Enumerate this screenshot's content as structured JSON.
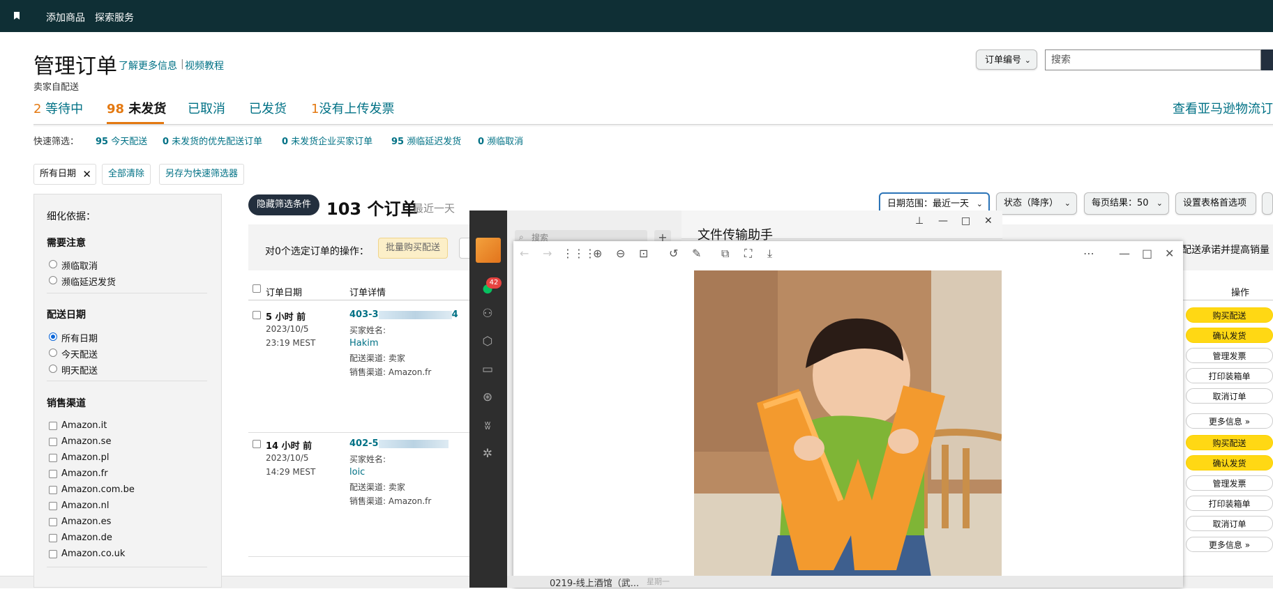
{
  "topbar": {
    "add_product": "添加商品",
    "explore": "探索服务"
  },
  "header": {
    "title": "管理订单",
    "learn_more": "了解更多信息",
    "video": "视频教程",
    "subtitle": "卖家自配送",
    "search_select": "订单编号",
    "search_placeholder": "搜索"
  },
  "tabs": [
    {
      "num": "2",
      "label": " 等待中"
    },
    {
      "num": "98",
      "label": " 未发货"
    },
    {
      "num": "",
      "label": "已取消"
    },
    {
      "num": "",
      "label": "已发货"
    },
    {
      "num": "1",
      "label": "没有上传发票"
    }
  ],
  "tab_right": "查看亚马逊物流订",
  "quick_filter": {
    "label": "快速筛选：",
    "items": [
      {
        "n": "95",
        "t": " 今天配送"
      },
      {
        "n": "0",
        "t": " 未发货的优先配送订单"
      },
      {
        "n": "0",
        "t": " 未发货企业买家订单"
      },
      {
        "n": "95",
        "t": " 濒临延迟发货"
      },
      {
        "n": "0",
        "t": " 濒临取消"
      }
    ]
  },
  "chips": {
    "all_dates": "所有日期",
    "clear_all": "全部清除",
    "save_filter": "另存为快速筛选器"
  },
  "sidebar": {
    "refine": "细化依据：",
    "attention_head": "需要注意",
    "attention": [
      "濒临取消",
      "濒临延迟发货"
    ],
    "ship_date_head": "配送日期",
    "ship_dates": [
      "所有日期",
      "今天配送",
      "明天配送"
    ],
    "channel_head": "销售渠道",
    "channels": [
      "Amazon.it",
      "Amazon.se",
      "Amazon.pl",
      "Amazon.fr",
      "Amazon.com.be",
      "Amazon.nl",
      "Amazon.es",
      "Amazon.de",
      "Amazon.co.uk"
    ]
  },
  "list": {
    "hide_filter": "隐藏筛选条件",
    "count": "103 个订单",
    "range": "最近一天",
    "date_range": "日期范围：最近一天",
    "status": "状态（降序）",
    "per_page": "每页结果：50",
    "table_pref": "设置表格首选项",
    "bulk_label": "对0个选定订单的操作：",
    "bulk_buy": "批量购买配送",
    "promo_right": "配送承诺并提高销量",
    "col_date": "订单日期",
    "col_detail": "订单详情",
    "col_action": "操作"
  },
  "orders": [
    {
      "ago": "5 小时 前",
      "date": "2023/10/5",
      "time": "23:19 MEST",
      "id_start": "403-3",
      "id_end": "4",
      "buyer_label": "买家姓名:",
      "buyer": "Hakim",
      "ship_channel": "配送渠道: 卖家",
      "sales_channel": "销售渠道: Amazon.fr"
    },
    {
      "ago": "14 小时 前",
      "date": "2023/10/5",
      "time": "14:29 MEST",
      "id_start": "402-5",
      "id_end": "",
      "buyer_label": "买家姓名:",
      "buyer": "loic",
      "ship_channel": "配送渠道: 卖家",
      "sales_channel": "销售渠道: Amazon.fr"
    }
  ],
  "actions": [
    "购买配送",
    "确认发货",
    "管理发票",
    "打印装箱单",
    "取消订单",
    "更多信息 »"
  ],
  "wechat": {
    "badge": "42",
    "search": "搜索",
    "chat_title": "文件传输助手",
    "bottom_chat": "0219-线上酒馆（武...",
    "bottom_date": "星期一"
  },
  "colors": {
    "topbar": "#0f2f35",
    "accent_orange": "#e47911",
    "link": "#007185",
    "action_yellow": "#ffd814",
    "wechat_green": "#07c160"
  }
}
